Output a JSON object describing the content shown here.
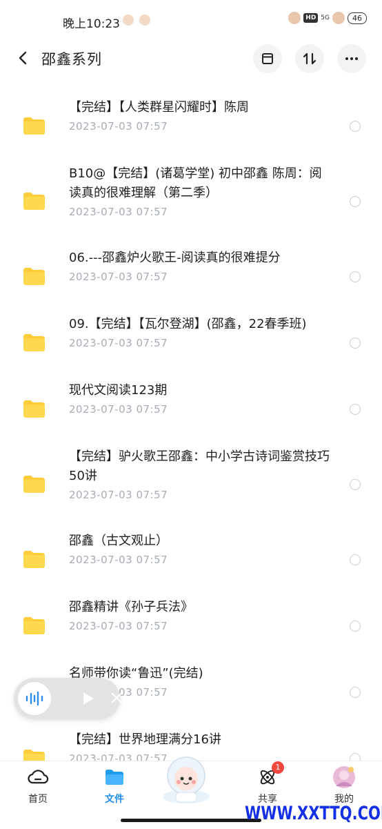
{
  "status_bar": {
    "time": "晚上10:23",
    "hd": "HD",
    "network": "5G",
    "battery": "46"
  },
  "header": {
    "title": "邵鑫系列"
  },
  "files": [
    {
      "name": "【完结】【人类群星闪耀时】陈周",
      "date": "2023-07-03  07:57"
    },
    {
      "name": "B10@【完结】(诸葛学堂) 初中邵鑫 陈周：阅读真的很难理解（第二季）",
      "date": "2023-07-03  07:57"
    },
    {
      "name": "06.---邵鑫炉火歌王-阅读真的很难提分",
      "date": "2023-07-03  07:57"
    },
    {
      "name": "09.【完结】【瓦尔登湖】(邵鑫，22春季班)",
      "date": "2023-07-03  07:57"
    },
    {
      "name": "现代文阅读123期",
      "date": "2023-07-03  07:57"
    },
    {
      "name": "【完结】驴火歌王邵鑫：中小学古诗词鉴赏技巧50讲",
      "date": "2023-07-03  07:57"
    },
    {
      "name": "邵鑫（古文观止）",
      "date": "2023-07-03  07:57"
    },
    {
      "name": "邵鑫精讲《孙子兵法》",
      "date": "2023-07-03  07:57"
    },
    {
      "name": "名师带你读“鲁迅”(完结)",
      "date": "2023-07-03  07:57"
    },
    {
      "name": "【完结】世界地理满分16讲",
      "date": "2023-07-03  07:57"
    }
  ],
  "tabbar": {
    "tabs": [
      {
        "label": "首页",
        "icon": "cloud-icon"
      },
      {
        "label": "文件",
        "icon": "folder-icon"
      },
      {
        "label": "共享",
        "icon": "atom-icon",
        "badge": "1"
      },
      {
        "label": "我的",
        "icon": "avatar"
      }
    ]
  },
  "watermark": "WWW.XXTTQ.COM",
  "colors": {
    "accent": "#1e8cf0",
    "folder": "#ffd44d",
    "date": "#a6acb5",
    "badge": "#f0463c",
    "watermark": "#1430e6"
  }
}
